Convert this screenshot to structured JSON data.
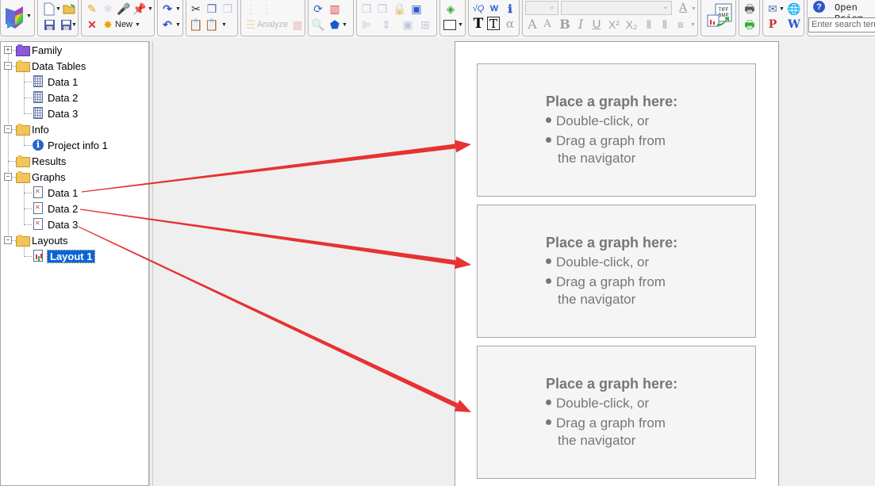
{
  "toolbar": {
    "new_label": "New",
    "analyze_label": "Analyze",
    "help_label": "Open Prism",
    "search_placeholder": "Enter search terms",
    "tiff_bmp_label": "TIFF BMP",
    "icons": [
      "prism-logo-icon",
      "new-document-icon",
      "open-folder-icon",
      "save-icon",
      "save-as-icon",
      "pencil-icon",
      "freeze-icon",
      "microphone-icon",
      "pin-icon",
      "delete-icon",
      "new-star-icon",
      "redo-icon",
      "undo-icon",
      "cut-icon",
      "copy-icon",
      "copy-format-icon",
      "paste-icon",
      "paste-special-icon",
      "analyze-icon",
      "change-data-icon",
      "refresh-graph-icon",
      "graph-icon",
      "zoom-icon",
      "shape-icon",
      "group-icon",
      "ungroup-icon",
      "lock-icon",
      "page-icon",
      "align-icon",
      "distribute-icon",
      "area-icon",
      "insert-equation-icon",
      "word-icon",
      "info-add-icon",
      "text-icon",
      "text-box-icon",
      "alpha-icon",
      "font-size-up-icon",
      "font-size-down-icon",
      "bold-icon",
      "italic-icon",
      "underline-icon",
      "superscript-icon",
      "subscript-icon",
      "export-tiff-bmp-icon",
      "print-icon",
      "print-preview-icon",
      "email-icon",
      "web-icon",
      "powerpoint-icon",
      "word-export-icon",
      "help-icon"
    ]
  },
  "navigator": {
    "items": [
      {
        "label": "Family",
        "type": "folder-purple",
        "level": 0,
        "expander": "+"
      },
      {
        "label": "Data Tables",
        "type": "folder",
        "level": 0,
        "expander": "-"
      },
      {
        "label": "Data 1",
        "type": "data-table",
        "level": 1
      },
      {
        "label": "Data 2",
        "type": "data-table",
        "level": 1
      },
      {
        "label": "Data 3",
        "type": "data-table",
        "level": 1
      },
      {
        "label": "Info",
        "type": "folder",
        "level": 0,
        "expander": "-"
      },
      {
        "label": "Project info 1",
        "type": "info",
        "level": 1
      },
      {
        "label": "Results",
        "type": "folder",
        "level": 0
      },
      {
        "label": "Graphs",
        "type": "folder",
        "level": 0,
        "expander": "-"
      },
      {
        "label": "Data 1",
        "type": "graph",
        "level": 1
      },
      {
        "label": "Data 2",
        "type": "graph",
        "level": 1
      },
      {
        "label": "Data 3",
        "type": "graph",
        "level": 1
      },
      {
        "label": "Layouts",
        "type": "folder",
        "level": 0,
        "expander": "-"
      },
      {
        "label": "Layout 1",
        "type": "layout",
        "level": 1,
        "selected": true
      }
    ]
  },
  "layout": {
    "placeholders": [
      {
        "title": "Place a graph here:",
        "bullet1": "Double-click, or",
        "bullet2": "Drag a graph from",
        "bullet2_cont": "the navigator"
      },
      {
        "title": "Place a graph here:",
        "bullet1": "Double-click, or",
        "bullet2": "Drag a graph from",
        "bullet2_cont": "the navigator"
      },
      {
        "title": "Place a graph here:",
        "bullet1": "Double-click, or",
        "bullet2": "Drag a graph from",
        "bullet2_cont": "the navigator"
      }
    ]
  },
  "annotations": {
    "arrow_color": "#e63232",
    "arrows": [
      {
        "from": "Graphs / Data 1",
        "to": "placeholder 1"
      },
      {
        "from": "Graphs / Data 2",
        "to": "placeholder 2"
      },
      {
        "from": "Graphs / Data 3",
        "to": "placeholder 3"
      }
    ]
  }
}
